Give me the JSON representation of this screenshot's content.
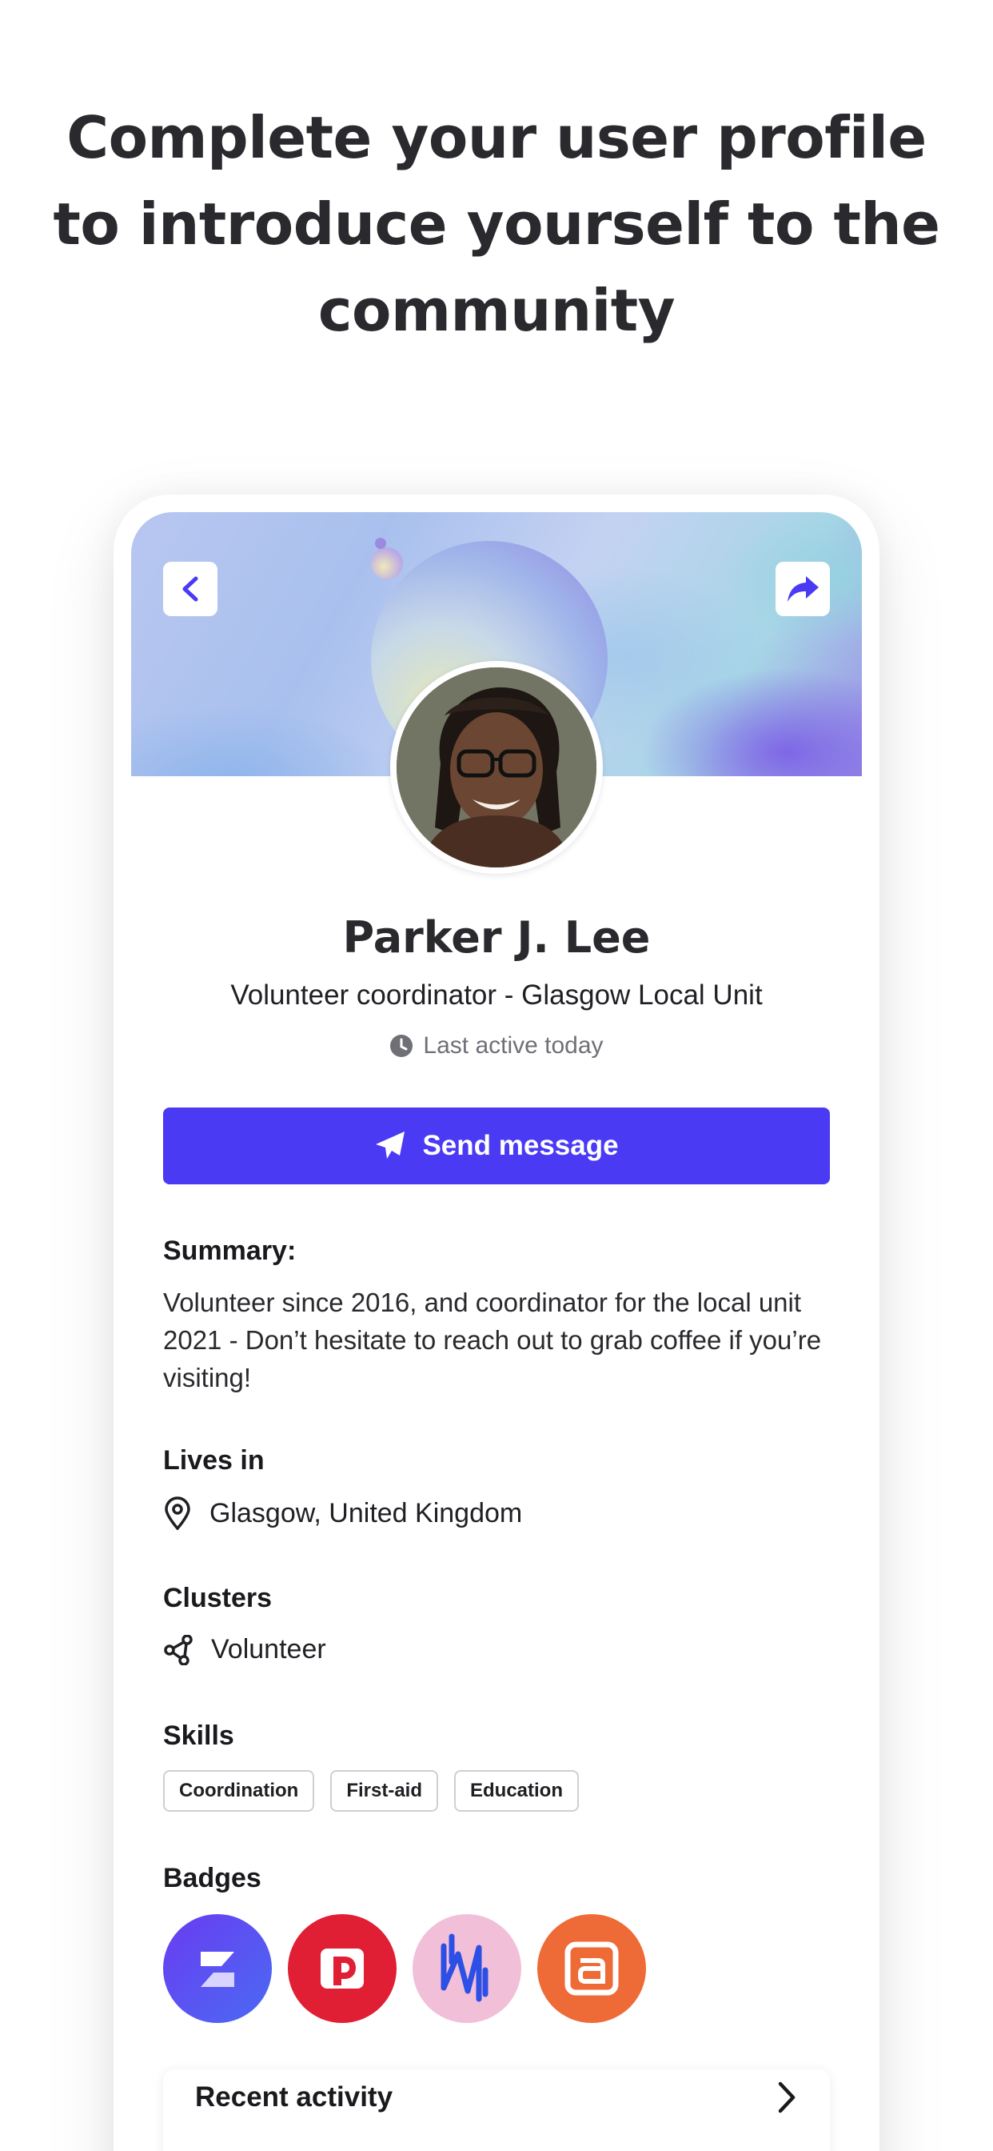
{
  "headline": "Complete your user profile to introduce yourself to the community",
  "profile": {
    "name": "Parker J. Lee",
    "role": "Volunteer coordinator - Glasgow Local Unit",
    "last_active": "Last active today",
    "send_message_label": "Send message"
  },
  "summary": {
    "label": "Summary:",
    "text": "Volunteer since 2016, and coordinator for the local unit 2021 - Don’t hesitate to reach out to grab coffee if you’re visiting!"
  },
  "lives_in": {
    "label": "Lives in",
    "value": "Glasgow, United Kingdom"
  },
  "clusters": {
    "label": "Clusters",
    "value": "Volunteer"
  },
  "skills": {
    "label": "Skills",
    "items": [
      "Coordination",
      "First-aid",
      "Education"
    ]
  },
  "badges": {
    "label": "Badges",
    "items": [
      {
        "icon": "stripes-logo-icon",
        "color": "#5b3ef0"
      },
      {
        "icon": "red-square-logo-icon",
        "color": "#e01e34"
      },
      {
        "icon": "zigzag-logo-icon",
        "color": "#f2bfd8"
      },
      {
        "icon": "square-a-logo-icon",
        "color": "#ee6a37"
      }
    ]
  },
  "recent_activity": {
    "label": "Recent activity"
  },
  "colors": {
    "accent": "#4a3af4",
    "text": "#2a2a2e",
    "muted": "#6f6f76"
  }
}
